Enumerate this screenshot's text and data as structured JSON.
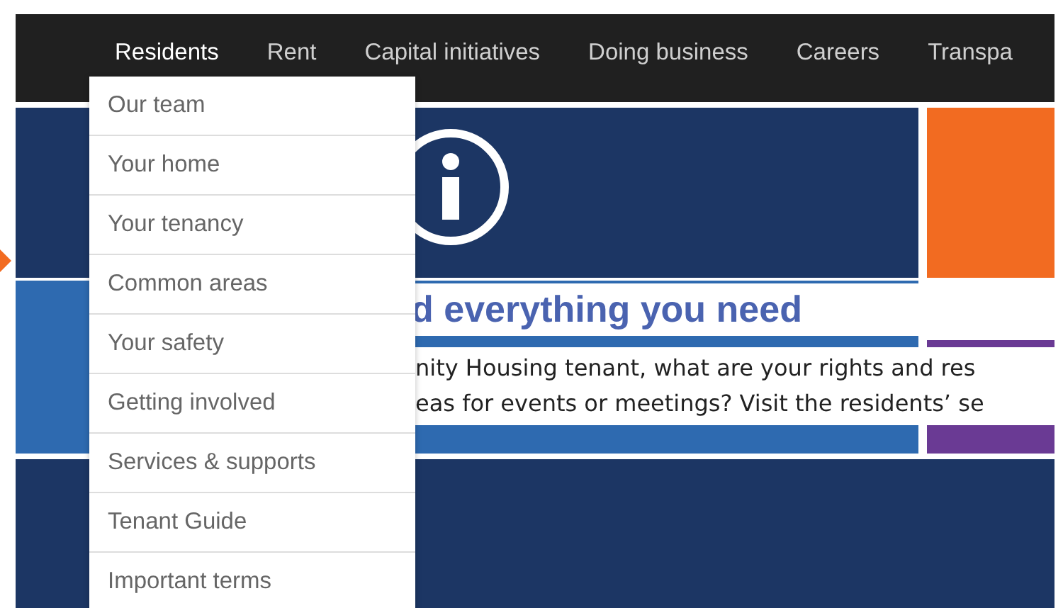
{
  "nav": [
    {
      "label": "Residents",
      "selected": true
    },
    {
      "label": "Rent",
      "selected": false
    },
    {
      "label": "Capital initiatives",
      "selected": false
    },
    {
      "label": "Doing business",
      "selected": false
    },
    {
      "label": "Careers",
      "selected": false
    },
    {
      "label": "Transpa",
      "selected": false
    }
  ],
  "dropdown": [
    "Our team",
    "Your home",
    "Your tenancy",
    "Common areas",
    "Your safety",
    "Getting involved",
    "Services & supports",
    "Tenant Guide",
    "Important terms"
  ],
  "feature": {
    "heading": "d everything you need",
    "lines": [
      "nity Housing tenant, what are your rights and res",
      "eas for events or meetings? Visit the residents’ se"
    ]
  }
}
